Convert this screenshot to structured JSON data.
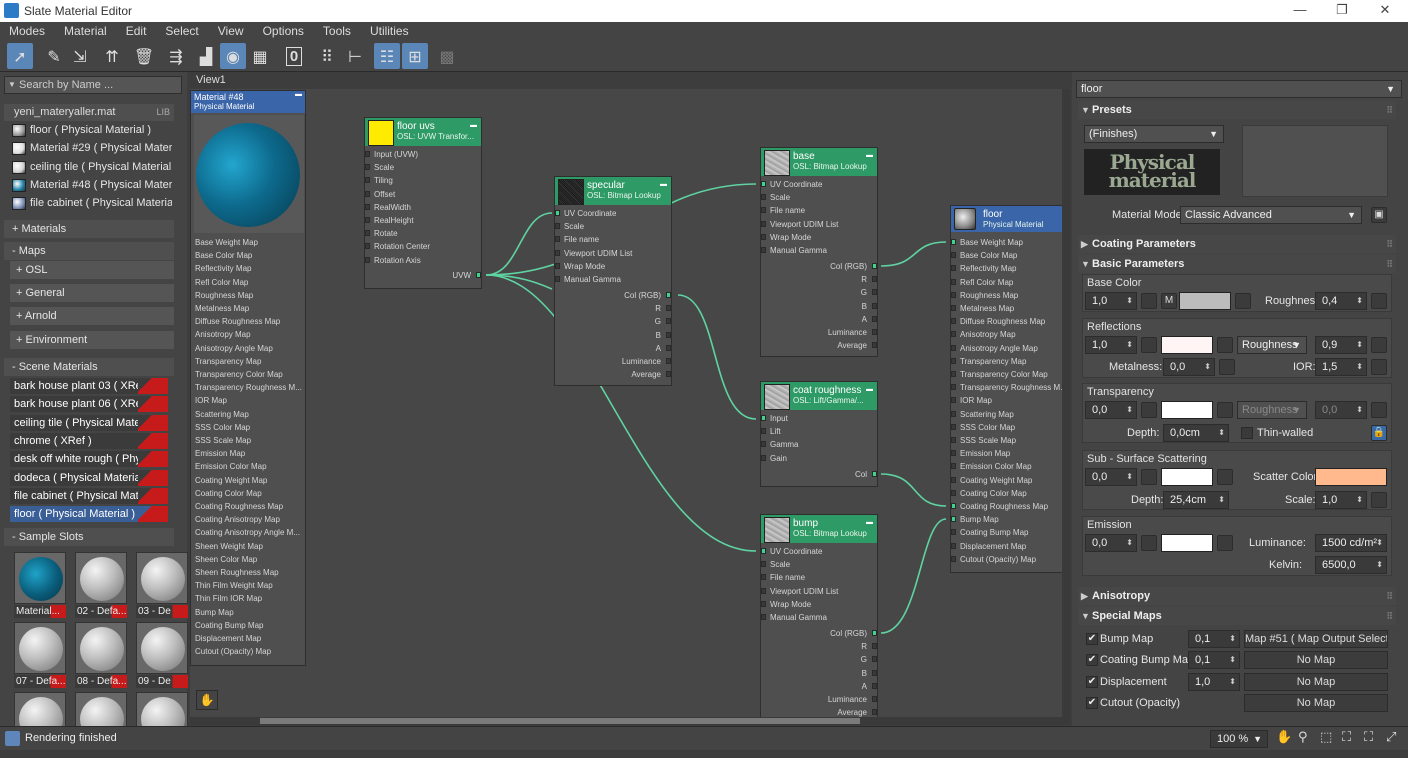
{
  "window": {
    "title": "Slate Material Editor",
    "minimize": "—",
    "maximize": "❐",
    "close": "✕"
  },
  "menu": [
    "Modes",
    "Material",
    "Edit",
    "Select",
    "View",
    "Options",
    "Tools",
    "Utilities"
  ],
  "toolbar": {
    "icons": [
      "select-arrow-icon",
      "eyedropper-icon",
      "assign-material-icon",
      "put-to-library-icon",
      "delete-icon",
      "move-children-icon",
      "hide-unused-slots-icon",
      "show-shaded-icon",
      "show-background-icon",
      "checker-background-icon",
      "zero-value-icon",
      "layout-all-icon",
      "layout-children-icon",
      "material-map-browser-icon",
      "parameter-editor-icon",
      "select-by-material-icon"
    ],
    "zero_label": "0"
  },
  "left": {
    "search_placeholder": "Search by Name ...",
    "library": {
      "name": "yeni_materyaller.mat",
      "tag": "LIB",
      "items": [
        {
          "label": "floor  ( Physical Material )",
          "color": "#9a9a9a"
        },
        {
          "label": "Material #29  ( Physical Materi...",
          "color": "#e0e0e0"
        },
        {
          "label": "ceiling tile  ( Physical Material )",
          "color": "#d4d4d4"
        },
        {
          "label": "Material #48  ( Physical Materi...",
          "color": "#1b7fa6"
        },
        {
          "label": "file cabinet  ( Physical Material )",
          "color": "#7b8fb5"
        }
      ]
    },
    "sections": {
      "materials": "+ Materials",
      "maps": "- Maps",
      "scene_materials": "- Scene Materials",
      "sample_slots": "- Sample Slots"
    },
    "maps_sub": [
      "+ OSL",
      "+ General",
      "+ Arnold",
      "+ Environment"
    ],
    "scene_materials": [
      "bark house plant 03  ( XRef )",
      "bark house plant 06  ( XRef )",
      "ceiling tile  ( Physical Material )",
      "chrome  ( XRef )",
      "desk off white rough  ( Physical...",
      "dodeca  ( Physical Material )",
      "file cabinet  ( Physical Material )",
      "floor  ( Physical Material )"
    ],
    "sample_slots": [
      {
        "label": "Material...",
        "blue": true
      },
      {
        "label": "02 - Defa...",
        "blue": false
      },
      {
        "label": "03 - De",
        "blue": false
      },
      {
        "label": "07 - Defa...",
        "blue": false
      },
      {
        "label": "08 - Defa...",
        "blue": false
      },
      {
        "label": "09 - De",
        "blue": false
      },
      {
        "label": "",
        "blue": false
      },
      {
        "label": "",
        "blue": false
      },
      {
        "label": "",
        "blue": false
      }
    ]
  },
  "view": {
    "tab": "View1",
    "nav_icon": "pan-hand-icon",
    "material48": {
      "name": "Material #48",
      "type": "Physical Material",
      "ports": [
        "Base Weight Map",
        "Base Color Map",
        "Reflectivity Map",
        "Refl Color Map",
        "Roughness Map",
        "Metalness Map",
        "Diffuse Roughness Map",
        "Anisotropy Map",
        "Anisotropy Angle Map",
        "Transparency Map",
        "Transparency Color Map",
        "Transparency Roughness M...",
        "IOR Map",
        "Scattering Map",
        "SSS Color Map",
        "SSS Scale Map",
        "Emission Map",
        "Emission Color Map",
        "Coating Weight Map",
        "Coating Color Map",
        "Coating Roughness Map",
        "Coating Anisotropy Map",
        "Coating Anisotropy Angle M...",
        "Sheen Weight Map",
        "Sheen Color Map",
        "Sheen Roughness Map",
        "Thin Film Weight Map",
        "Thin Film IOR Map",
        "Bump Map",
        "Coating Bump Map",
        "Displacement Map",
        "Cutout (Opacity) Map"
      ]
    },
    "floor_uvs": {
      "name": "floor uvs",
      "type": "OSL: UVW Transfor...",
      "inputs": [
        "Input (UVW)",
        "Scale",
        "Tiling",
        "Offset",
        "RealWidth",
        "RealHeight",
        "Rotate",
        "Rotation Center",
        "Rotation Axis"
      ],
      "output": "UVW"
    },
    "specular": {
      "name": "specular",
      "type": "OSL: Bitmap Lookup",
      "inputs": [
        "UV Coordinate",
        "Scale",
        "File name",
        "Viewport UDIM List",
        "Wrap Mode",
        "Manual Gamma"
      ],
      "outputs": [
        "Col (RGB)",
        "R",
        "G",
        "B",
        "A",
        "Luminance",
        "Average"
      ]
    },
    "base": {
      "name": "base",
      "type": "OSL: Bitmap Lookup",
      "inputs": [
        "UV Coordinate",
        "Scale",
        "File name",
        "Viewport UDIM List",
        "Wrap Mode",
        "Manual Gamma"
      ],
      "outputs": [
        "Col (RGB)",
        "R",
        "G",
        "B",
        "A",
        "Luminance",
        "Average"
      ]
    },
    "coat_roughness": {
      "name": "coat roughness",
      "type": "OSL: Lift/Gamma/...",
      "inputs": [
        "Input",
        "Lift",
        "Gamma",
        "Gain"
      ],
      "output": "Col"
    },
    "bump": {
      "name": "bump",
      "type": "OSL: Bitmap Lookup",
      "inputs": [
        "UV Coordinate",
        "Scale",
        "File name",
        "Viewport UDIM List",
        "Wrap Mode",
        "Manual Gamma"
      ],
      "outputs": [
        "Col (RGB)",
        "R",
        "G",
        "B",
        "A",
        "Luminance",
        "Average"
      ]
    },
    "floor": {
      "name": "floor",
      "type": "Physical Material",
      "ports": [
        "Base Weight Map",
        "Base Color Map",
        "Reflectivity Map",
        "Refl Color Map",
        "Roughness Map",
        "Metalness Map",
        "Diffuse Roughness Map",
        "Anisotropy Map",
        "Anisotropy Angle Map",
        "Transparency Map",
        "Transparency Color Map",
        "Transparency Roughness M...",
        "IOR Map",
        "Scattering Map",
        "SSS Color Map",
        "SSS Scale Map",
        "Emission Map",
        "Emission Color Map",
        "Coating Weight Map",
        "Coating Color Map",
        "Coating Roughness Map",
        "Bump Map",
        "Coating Bump Map",
        "Displacement Map",
        "Cutout (Opacity) Map"
      ]
    }
  },
  "right": {
    "material_name": "floor",
    "presets": {
      "title": "Presets",
      "dropdown": "(Finishes)",
      "image_text": "Physical material",
      "mode_label": "Material Mode:",
      "mode_value": "Classic Advanced"
    },
    "coating_title": "Coating Parameters",
    "basic_title": "Basic Parameters",
    "base_color": {
      "label": "Base Color",
      "weight": "1,0",
      "m": "M",
      "color": "#bcbcbc",
      "roughness_label": "Roughness:",
      "roughness": "0,4"
    },
    "reflections": {
      "label": "Reflections",
      "weight": "1,0",
      "color": "#fff5f5",
      "mode": "Roughness",
      "roughness": "0,9",
      "metalness_label": "Metalness:",
      "metalness": "0,0",
      "ior_label": "IOR:",
      "ior": "1,5"
    },
    "transparency": {
      "label": "Transparency",
      "weight": "0,0",
      "color": "#ffffff",
      "mode": "Roughness",
      "roughness": "0,0",
      "depth_label": "Depth:",
      "depth": "0,0cm",
      "thin": "Thin-walled"
    },
    "sss": {
      "label": "Sub - Surface Scattering",
      "weight": "0,0",
      "color": "#ffffff",
      "scatter_label": "Scatter Color:",
      "scatter_color": "#ffb98c",
      "depth_label": "Depth:",
      "depth": "25,4cm",
      "scale_label": "Scale:",
      "scale": "1,0"
    },
    "emission": {
      "label": "Emission",
      "weight": "0,0",
      "color": "#ffffff",
      "lum_label": "Luminance:",
      "luminance": "1500 cd/m²",
      "kelvin_label": "Kelvin:",
      "kelvin": "6500,0"
    },
    "anisotropy_title": "Anisotropy",
    "special_title": "Special Maps",
    "special_maps": [
      {
        "label": "Bump Map",
        "value": "0,1",
        "map": "Map #51  ( Map Output Select..."
      },
      {
        "label": "Coating Bump Map",
        "value": "0,1",
        "map": "No Map"
      },
      {
        "label": "Displacement",
        "value": "1,0",
        "map": "No Map"
      },
      {
        "label": "Cutout (Opacity)",
        "value": "",
        "map": "No Map"
      }
    ]
  },
  "status": {
    "text": "Rendering finished",
    "zoom": "100 %",
    "icons": [
      "pan-icon",
      "zoom-icon",
      "zoom-region-icon",
      "zoom-extents-icon",
      "zoom-extents-selected-icon",
      "maximize-viewport-icon"
    ]
  }
}
